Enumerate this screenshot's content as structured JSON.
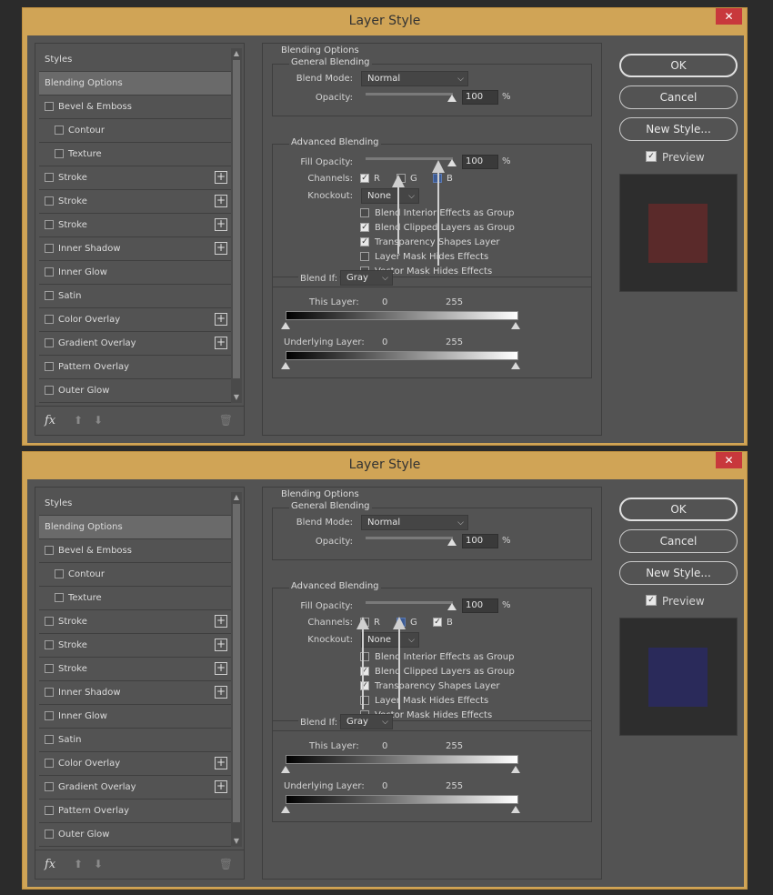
{
  "dialogs": [
    {
      "title": "Layer Style",
      "close_label": "✕",
      "styles": [
        {
          "label": "Styles",
          "type": "header"
        },
        {
          "label": "Blending Options",
          "type": "header",
          "selected": true
        },
        {
          "label": "Bevel & Emboss",
          "type": "item",
          "indent": 0
        },
        {
          "label": "Contour",
          "type": "item",
          "indent": 1
        },
        {
          "label": "Texture",
          "type": "item",
          "indent": 1
        },
        {
          "label": "Stroke",
          "type": "item",
          "indent": 0,
          "plus": true
        },
        {
          "label": "Stroke",
          "type": "item",
          "indent": 0,
          "plus": true
        },
        {
          "label": "Stroke",
          "type": "item",
          "indent": 0,
          "plus": true
        },
        {
          "label": "Inner Shadow",
          "type": "item",
          "indent": 0,
          "plus": true
        },
        {
          "label": "Inner Glow",
          "type": "item",
          "indent": 0
        },
        {
          "label": "Satin",
          "type": "item",
          "indent": 0
        },
        {
          "label": "Color Overlay",
          "type": "item",
          "indent": 0,
          "plus": true
        },
        {
          "label": "Gradient Overlay",
          "type": "item",
          "indent": 0,
          "plus": true
        },
        {
          "label": "Pattern Overlay",
          "type": "item",
          "indent": 0
        },
        {
          "label": "Outer Glow",
          "type": "item",
          "indent": 0
        }
      ],
      "fx_label": "fx",
      "blending_options_title": "Blending Options",
      "general_blending_title": "General Blending",
      "blend_mode_label": "Blend Mode:",
      "blend_mode_value": "Normal",
      "opacity_label": "Opacity:",
      "opacity_value": "100",
      "percent": "%",
      "advanced_blending_title": "Advanced Blending",
      "fill_opacity_label": "Fill Opacity:",
      "fill_opacity_value": "100",
      "channels_label": "Channels:",
      "channels": [
        {
          "label": "R",
          "state": "on"
        },
        {
          "label": "G",
          "state": "off"
        },
        {
          "label": "B",
          "state": "blue"
        }
      ],
      "knockout_label": "Knockout:",
      "knockout_value": "None",
      "advanced_options": [
        {
          "label": "Blend Interior Effects as Group",
          "checked": false
        },
        {
          "label": "Blend Clipped Layers as Group",
          "checked": true
        },
        {
          "label": "Transparency Shapes Layer",
          "checked": true
        },
        {
          "label": "Layer Mask Hides Effects",
          "checked": false
        },
        {
          "label": "Vector Mask Hides Effects",
          "checked": false
        }
      ],
      "blend_if_label": "Blend If:",
      "blend_if_value": "Gray",
      "this_layer_label": "This Layer:",
      "this_layer_min": "0",
      "this_layer_max": "255",
      "underlying_layer_label": "Underlying Layer:",
      "underlying_min": "0",
      "underlying_max": "255",
      "ok_label": "OK",
      "cancel_label": "Cancel",
      "new_style_label": "New Style...",
      "preview_label": "Preview",
      "preview_color": "#5a2a2a"
    },
    {
      "title": "Layer Style",
      "close_label": "✕",
      "styles": [
        {
          "label": "Styles",
          "type": "header"
        },
        {
          "label": "Blending Options",
          "type": "header",
          "selected": true
        },
        {
          "label": "Bevel & Emboss",
          "type": "item",
          "indent": 0
        },
        {
          "label": "Contour",
          "type": "item",
          "indent": 1
        },
        {
          "label": "Texture",
          "type": "item",
          "indent": 1
        },
        {
          "label": "Stroke",
          "type": "item",
          "indent": 0,
          "plus": true
        },
        {
          "label": "Stroke",
          "type": "item",
          "indent": 0,
          "plus": true
        },
        {
          "label": "Stroke",
          "type": "item",
          "indent": 0,
          "plus": true
        },
        {
          "label": "Inner Shadow",
          "type": "item",
          "indent": 0,
          "plus": true
        },
        {
          "label": "Inner Glow",
          "type": "item",
          "indent": 0
        },
        {
          "label": "Satin",
          "type": "item",
          "indent": 0
        },
        {
          "label": "Color Overlay",
          "type": "item",
          "indent": 0,
          "plus": true
        },
        {
          "label": "Gradient Overlay",
          "type": "item",
          "indent": 0,
          "plus": true
        },
        {
          "label": "Pattern Overlay",
          "type": "item",
          "indent": 0
        },
        {
          "label": "Outer Glow",
          "type": "item",
          "indent": 0
        }
      ],
      "fx_label": "fx",
      "blending_options_title": "Blending Options",
      "general_blending_title": "General Blending",
      "blend_mode_label": "Blend Mode:",
      "blend_mode_value": "Normal",
      "opacity_label": "Opacity:",
      "opacity_value": "100",
      "percent": "%",
      "advanced_blending_title": "Advanced Blending",
      "fill_opacity_label": "Fill Opacity:",
      "fill_opacity_value": "100",
      "channels_label": "Channels:",
      "channels": [
        {
          "label": "R",
          "state": "off"
        },
        {
          "label": "G",
          "state": "blue"
        },
        {
          "label": "B",
          "state": "on"
        }
      ],
      "knockout_label": "Knockout:",
      "knockout_value": "None",
      "advanced_options": [
        {
          "label": "Blend Interior Effects as Group",
          "checked": false
        },
        {
          "label": "Blend Clipped Layers as Group",
          "checked": true
        },
        {
          "label": "Transparency Shapes Layer",
          "checked": true
        },
        {
          "label": "Layer Mask Hides Effects",
          "checked": false
        },
        {
          "label": "Vector Mask Hides Effects",
          "checked": false
        }
      ],
      "blend_if_label": "Blend If:",
      "blend_if_value": "Gray",
      "this_layer_label": "This Layer:",
      "this_layer_min": "0",
      "this_layer_max": "255",
      "underlying_layer_label": "Underlying Layer:",
      "underlying_min": "0",
      "underlying_max": "255",
      "ok_label": "OK",
      "cancel_label": "Cancel",
      "new_style_label": "New Style...",
      "preview_label": "Preview",
      "preview_color": "#2a2a5a"
    }
  ]
}
